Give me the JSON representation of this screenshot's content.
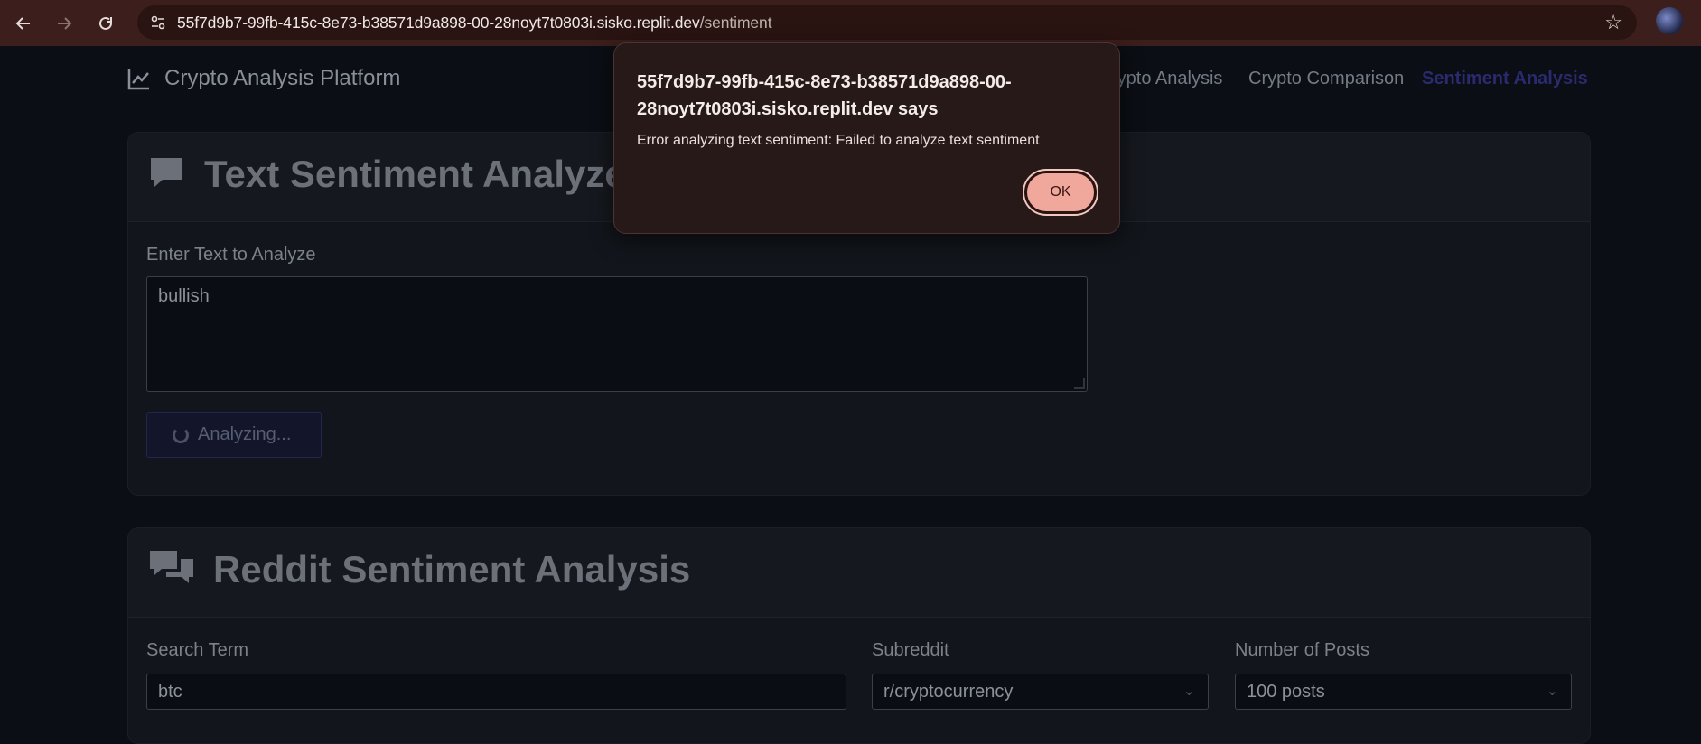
{
  "browser": {
    "url_host": "55f7d9b7-99fb-415c-8e73-b38571d9a898-00-28noyt7t0803i.sisko.replit.dev",
    "url_path": "/sentiment",
    "back_icon": "arrow-left-icon",
    "forward_icon": "arrow-right-icon",
    "reload_icon": "reload-icon",
    "bookmark_icon": "star-icon"
  },
  "header": {
    "brand": "Crypto Analysis Platform",
    "nav": [
      {
        "label": "rypto Analysis"
      },
      {
        "label": "Crypto Comparison"
      },
      {
        "label": "Sentiment Analysis",
        "active": true
      }
    ]
  },
  "text_analyzer": {
    "title": "Text Sentiment Analyzer",
    "input_label": "Enter Text to Analyze",
    "input_value": "bullish",
    "button_label": "Analyzing..."
  },
  "reddit": {
    "title": "Reddit Sentiment Analysis",
    "search_label": "Search Term",
    "search_value": "btc",
    "subreddit_label": "Subreddit",
    "subreddit_value": "r/cryptocurrency",
    "posts_label": "Number of Posts",
    "posts_value": "100 posts"
  },
  "dialog": {
    "title": "55f7d9b7-99fb-415c-8e73-b38571d9a898-00-28noyt7t0803i.sisko.replit.dev says",
    "message": "Error analyzing text sentiment: Failed to analyze text sentiment",
    "ok_label": "OK"
  },
  "colors": {
    "chrome_bg": "#3c1e1c",
    "page_bg": "#0b0e14",
    "active_nav": "#2a2a6e",
    "ok_button": "#f0a79c"
  }
}
